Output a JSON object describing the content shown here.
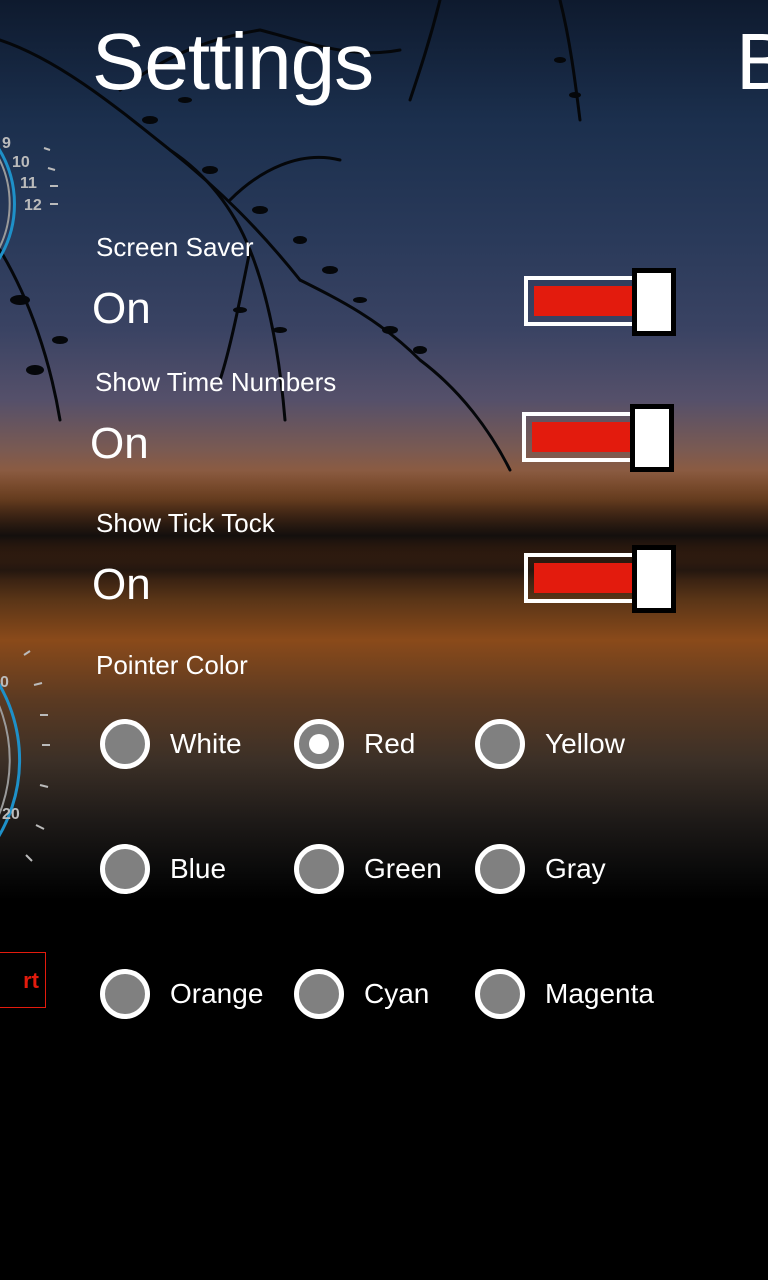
{
  "page": {
    "title": "Settings",
    "next_title_fragment": "B"
  },
  "settings": [
    {
      "label": "Screen Saver",
      "value": "On",
      "on": true
    },
    {
      "label": "Show Time Numbers",
      "value": "On",
      "on": true
    },
    {
      "label": "Show Tick Tock",
      "value": "On",
      "on": true
    }
  ],
  "pointer_color": {
    "label": "Pointer Color",
    "selected": "Red",
    "options": [
      "White",
      "Red",
      "Yellow",
      "Blue",
      "Green",
      "Gray",
      "Orange",
      "Cyan",
      "Magenta"
    ]
  },
  "gauges": {
    "top_ticks": [
      "9",
      "10",
      "11",
      "12"
    ],
    "bottom_ticks": [
      "0",
      "20"
    ]
  },
  "side_button": {
    "label": "rt"
  },
  "colors": {
    "accent": "#e31b0d",
    "radio_fill": "#808080",
    "gauge_ring": "#1e90c8"
  }
}
